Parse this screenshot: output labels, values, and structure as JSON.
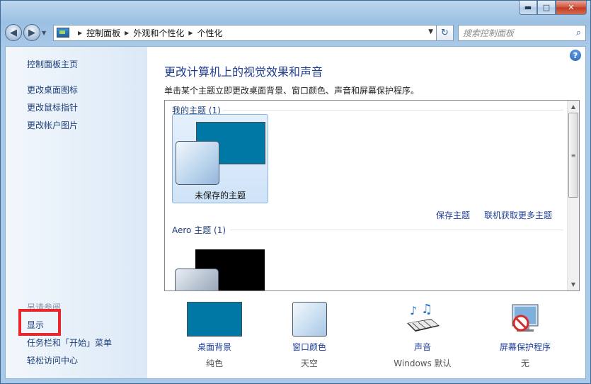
{
  "window": {
    "minimize": "▬",
    "maximize": "□",
    "close": "✕"
  },
  "nav": {
    "breadcrumb": [
      "控制面板",
      "外观和个性化",
      "个性化"
    ],
    "search_placeholder": "搜索控制面板"
  },
  "sidebar": {
    "links": [
      "控制面板主页",
      "更改桌面图标",
      "更改鼠标指针",
      "更改帐户图片"
    ],
    "see_also_header": "另请参阅",
    "see_also": [
      "显示",
      "任务栏和「开始」菜单",
      "轻松访问中心"
    ]
  },
  "main": {
    "title": "更改计算机上的视觉效果和声音",
    "subtitle": "单击某个主题立即更改桌面背景、窗口颜色、声音和屏幕保护程序。",
    "my_themes_header": "我的主题 (1)",
    "unsaved_theme": "未保存的主题",
    "save_theme": "保存主题",
    "get_more_themes": "联机获取更多主题",
    "aero_header": "Aero 主题 (1)"
  },
  "bottom": [
    {
      "label": "桌面背景",
      "value": "纯色",
      "icon": "desktop-background-icon",
      "color": "#0078a6"
    },
    {
      "label": "窗口颜色",
      "value": "天空",
      "icon": "window-color-icon"
    },
    {
      "label": "声音",
      "value": "Windows 默认",
      "icon": "sound-icon"
    },
    {
      "label": "屏幕保护程序",
      "value": "无",
      "icon": "screensaver-icon"
    }
  ]
}
